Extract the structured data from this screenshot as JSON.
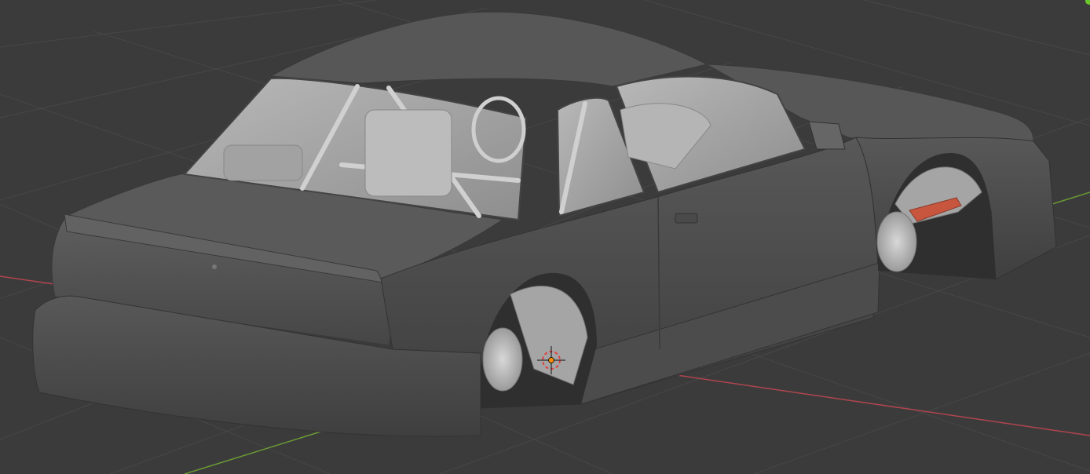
{
  "viewport": {
    "background": "#3b3b3b",
    "grid_color": "#474747",
    "x_axis_color": "#b0454f",
    "y_axis_color": "#6a9a35"
  },
  "object": {
    "body_color": "#555555",
    "interior_color": "#a9a9a9",
    "wheel_color": "#bdbdbd",
    "accent_color": "#c8563f"
  },
  "gizmo": {
    "origin_color": "#ff8a00",
    "cursor_ring_color": "#e04040"
  },
  "corner_indicator": {
    "color": "#6ac82c"
  }
}
